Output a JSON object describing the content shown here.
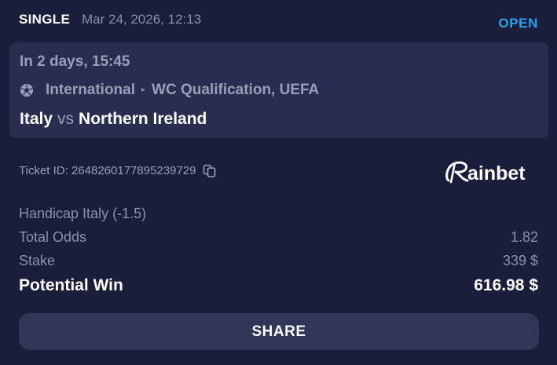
{
  "header": {
    "bet_type": "SINGLE",
    "placed_at": "Mar 24, 2026, 12:13",
    "status": "OPEN"
  },
  "event": {
    "start_time": "In 2 days, 15:45",
    "sport_icon": "soccer-ball-icon",
    "category": "International",
    "competition": "WC Qualification, UEFA",
    "home_team": "Italy",
    "vs": "vs",
    "away_team": "Northern Ireland"
  },
  "ticket": {
    "label": "Ticket ID:",
    "id": "2648260177895239729",
    "copy_icon": "copy-icon"
  },
  "brand": {
    "logo_text": "Rainbet"
  },
  "bet": {
    "selection": "Handicap Italy (-1.5)",
    "odds_label": "Total Odds",
    "odds_value": "1.82",
    "stake_label": "Stake",
    "stake_value": "339 $",
    "win_label": "Potential Win",
    "win_value": "616.98 $"
  },
  "actions": {
    "share_label": "SHARE"
  },
  "colors": {
    "background": "#1b1e3a",
    "event_panel": "#292d50",
    "share_button": "#313556",
    "status_open": "#2aa3f0",
    "muted_text": "#8c90a8"
  }
}
